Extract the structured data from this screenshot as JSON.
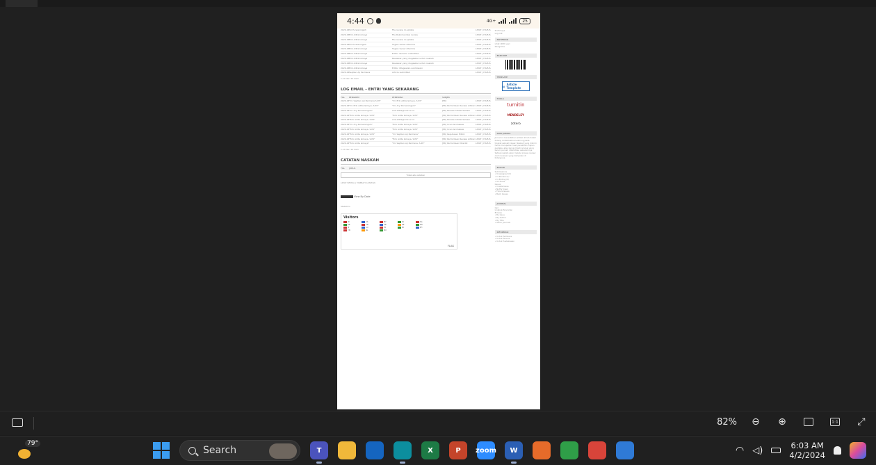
{
  "viewer": {
    "zoom_label": "82%",
    "zoom_out_icon": "zoom-out-icon",
    "zoom_in_icon": "zoom-in-icon",
    "fit_icon": "fit-page-icon",
    "actual_size_label": "1:1",
    "fullscreen_icon": "expand-icon"
  },
  "phone": {
    "time": "4:44",
    "battery": "25",
    "network": "4G+"
  },
  "doc": {
    "section1_title": "LOG EMAIL - ENTRI YANG SEKARANG",
    "section2_title": "CATATAN NASKAH",
    "visitors_title": "Visitors",
    "flag_counter": "FLAG",
    "history_link": "View By Date",
    "footer_note": "Statistics",
    "rows_top": [
      {
        "c1": "2020-04-11",
        "c2": "Sri Purwaningsih",
        "c3": "File review di-update",
        "c4": "",
        "c5": "LIHAT | HAPUS"
      },
      {
        "c1": "2020-04-11",
        "c2": "Erik Adita Ismaya",
        "c3": "File Rekomendasi review",
        "c4": "",
        "c5": "LIHAT | HAPUS"
      },
      {
        "c1": "2020-04-11",
        "c2": "Erik Adita Ismaya",
        "c3": "File review di-update",
        "c4": "",
        "c5": "LIHAT | HAPUS"
      },
      {
        "c1": "2020-04-11",
        "c2": "Sri Purwaningsih",
        "c3": "Tugas review diterima",
        "c4": "",
        "c5": "LIHAT | HAPUS"
      },
      {
        "c1": "2020-04-11",
        "c2": "Erik Adita Ismaya",
        "c3": "Tugas review diterima",
        "c4": "",
        "c5": "LIHAT | HAPUS"
      },
      {
        "c1": "2020-04-11",
        "c2": "Erik Adita Ismaya",
        "c3": "Editor decision submitted",
        "c4": "",
        "c5": "LIHAT | HAPUS"
      },
      {
        "c1": "2020-04-11",
        "c2": "Erik Adita Ismaya",
        "c3": "Reviewer yang diugaskan untuk naskah",
        "c4": "",
        "c5": "LIHAT | HAPUS"
      },
      {
        "c1": "2020-04-11",
        "c2": "Erik Adita Ismaya",
        "c3": "Reviewer yang diugaskan untuk naskah",
        "c4": "",
        "c5": "LIHAT | HAPUS"
      },
      {
        "c1": "2020-04-11",
        "c2": "Erik Adita Ismaya",
        "c3": "Editor ditugaskan submission",
        "c4": "",
        "c5": "LIHAT | HAPUS"
      },
      {
        "c1": "2020-04-11",
        "c2": "Septian Aji Permana",
        "c3": "Article submitted",
        "c4": "",
        "c5": "LIHAT | HAPUS"
      }
    ],
    "rows_email": [
      {
        "c1": "2020-04-11",
        "c2": "\"Dr. Septian Aji Permana S.Pd\"",
        "c3": "\"Dr. Erik Adita Ismaya, S.Pd\"",
        "c4": "[PK]",
        "c5": "LIHAT | HAPUS"
      },
      {
        "c1": "2020-04-11",
        "c2": "\"Dr. Erik Adita Ismaya, S.Pd\"",
        "c3": "\"Dr. Ary Purwaningsih\"",
        "c4": "[PK] Permintaan Review Artikel",
        "c5": "LIHAT | HAPUS"
      },
      {
        "c1": "2020-04-11",
        "c2": "\"Dr. Ary Purwaningsih\"",
        "c3": "erik.adita@umk.ac.id",
        "c4": "[PK] Review Artikel Selesai",
        "c5": "LIHAT | HAPUS"
      },
      {
        "c1": "2020-04-11",
        "c2": "\"Erik Adita Ismaya, S.Pd\"",
        "c3": "\"Erik Adita Ismaya, S.Pd\"",
        "c4": "[PK] Permintaan Review Artikel",
        "c5": "LIHAT | HAPUS"
      },
      {
        "c1": "2020-04-11",
        "c2": "\"Erik Adita Ismaya, S.Pd\"",
        "c3": "erik.adita@umk.ac.id",
        "c4": "[PK] Review Artikel Selesai",
        "c5": "LIHAT | HAPUS"
      },
      {
        "c1": "2020-04-11",
        "c2": "\"Dr. Ary Purwaningsih\"",
        "c3": "\"Erik Adita Ismaya, S.Pd\"",
        "c4": "[PK] Ucan terimakasi",
        "c5": "LIHAT | HAPUS"
      },
      {
        "c1": "2020-04-11",
        "c2": "\"Erik Adita Ismaya, S.Pd\"",
        "c3": "\"Erik Adita Ismaya, S.Pd\"",
        "c4": "[PK] Ucan terimakasi",
        "c5": "LIHAT | HAPUS"
      },
      {
        "c1": "2020-04-11",
        "c2": "\"Erik Adita Ismaya, S.Pd\"",
        "c3": "\"Dr. Septian Aji Permana\"",
        "c4": "[PK] Keputusan Editor",
        "c5": "LIHAT | HAPUS"
      },
      {
        "c1": "2020-04-11",
        "c2": "\"Erik Adita Ismaya, S.Pd\"",
        "c3": "\"Erik Adita Ismaya, S.Pd\"",
        "c4": "[PK] Permintaan Review Artikel",
        "c5": "LIHAT | HAPUS"
      },
      {
        "c1": "2020-04-11",
        "c2": "\"Erik Adita Ismaya\"",
        "c3": "\"Dr. Septian Aji Permana, S.Pd\"",
        "c4": "[PK] Permintaan Diterbit",
        "c5": "LIHAT | HAPUS"
      }
    ],
    "sidebar": {
      "notif_title": "NOTIFIKASI",
      "barcode_title": "BARCODE",
      "template_title": "TEMPLATE",
      "template_label": "Article Template",
      "tools_title": "TOOLS",
      "tool1": "turnitin",
      "tool2": "MENDELEY",
      "tool3": "zotero",
      "about_title": "DATA JURNAL",
      "editor_title": "EDITOR",
      "journal_title": "JOURNAL",
      "info_title": "INFORMASI"
    }
  },
  "taskbar": {
    "temperature": "79°",
    "search_label": "Search",
    "time": "6:03 AM",
    "date": "4/2/2024",
    "apps": [
      {
        "name": "teams",
        "color": "#4b53bc",
        "label": "T"
      },
      {
        "name": "file-explorer",
        "color": "#f0b83a",
        "label": ""
      },
      {
        "name": "mail",
        "color": "#1565c0",
        "label": ""
      },
      {
        "name": "edge",
        "color": "#0c8e9e",
        "label": ""
      },
      {
        "name": "excel",
        "color": "#1d7a45",
        "label": "X"
      },
      {
        "name": "powerpoint",
        "color": "#c4442a",
        "label": "P"
      },
      {
        "name": "zoom",
        "color": "#2d8cff",
        "label": "zoom"
      },
      {
        "name": "word",
        "color": "#2b5fb4",
        "label": "W"
      },
      {
        "name": "firefox",
        "color": "#e66b2a",
        "label": ""
      },
      {
        "name": "chrome",
        "color": "#2f9e48",
        "label": ""
      },
      {
        "name": "chrome-profile",
        "color": "#d8443a",
        "label": ""
      },
      {
        "name": "photos",
        "color": "#2f7ad6",
        "label": ""
      }
    ]
  }
}
